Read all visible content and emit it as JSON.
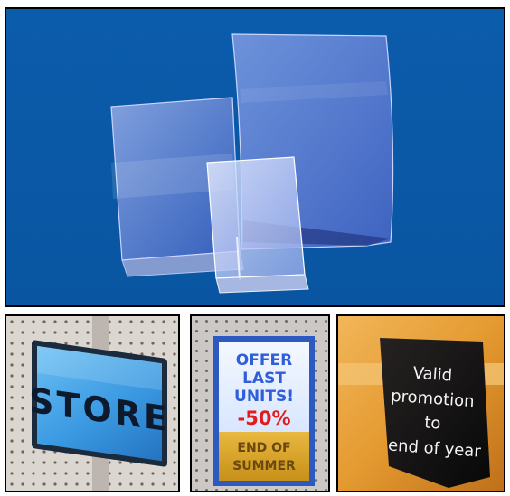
{
  "panels": {
    "store_sign": {
      "text": "STORE"
    },
    "offer_sign": {
      "line1": "OFFER",
      "line2": "LAST",
      "line3": "UNITS!",
      "discount": "-50%",
      "footer1": "END OF",
      "footer2": "SUMMER"
    },
    "promo_sign": {
      "line1": "Valid",
      "line2": "promotion",
      "line3": "to",
      "line4": "end of year"
    }
  },
  "colors": {
    "top_background": "#0a5aa8",
    "acrylic_tint": "#8aa6e0",
    "pegboard": "#d9d4cf",
    "store_sign_blue": "#4aa8e8",
    "offer_blue": "#3060d8",
    "offer_red": "#e02020",
    "promo_orange": "#e8a040",
    "promo_black": "#141414"
  }
}
